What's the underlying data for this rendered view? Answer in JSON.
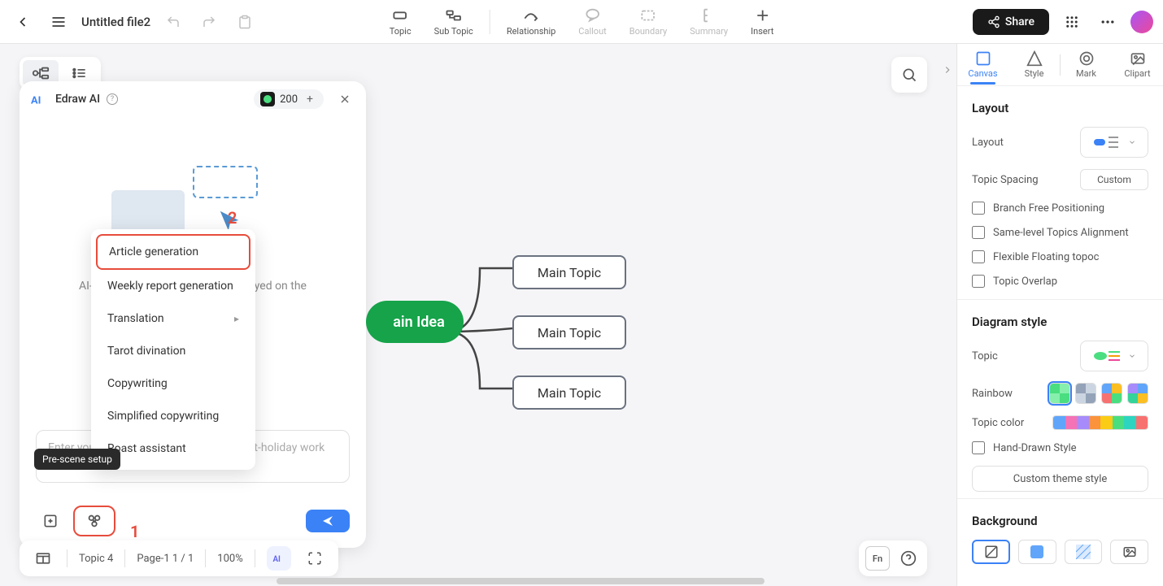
{
  "file": {
    "title": "Untitled file2"
  },
  "toolbar": {
    "topic": "Topic",
    "subtopic": "Sub Topic",
    "relationship": "Relationship",
    "callout": "Callout",
    "boundary": "Boundary",
    "summary": "Summary",
    "insert": "Insert"
  },
  "share": {
    "label": "Share"
  },
  "ai": {
    "title": "Edraw AI",
    "credits": "200",
    "hint": "AI-generated content can be displayed on the canvas~",
    "placeholder": "Enter your question, such as \"perfect post-holiday work resumption plan\"",
    "submenu": {
      "article": "Article generation",
      "weekly": "Weekly report generation",
      "translation": "Translation",
      "tarot": "Tarot divination",
      "copywriting": "Copywriting",
      "simplified": "Simplified copywriting",
      "roast": "Roast assistant"
    },
    "tooltip": "Pre-scene setup"
  },
  "annotations": {
    "one": "1",
    "two": "2"
  },
  "mindmap": {
    "root": "ain Idea",
    "child1": "Main Topic",
    "child2": "Main Topic",
    "child3": "Main Topic"
  },
  "rightPanel": {
    "tabs": {
      "canvas": "Canvas",
      "style": "Style",
      "mark": "Mark",
      "clipart": "Clipart"
    },
    "layout": {
      "title": "Layout",
      "layout_label": "Layout",
      "spacing_label": "Topic Spacing",
      "custom": "Custom",
      "branch_free": "Branch Free Positioning",
      "same_level": "Same-level Topics Alignment",
      "flexible": "Flexible Floating topoc",
      "overlap": "Topic Overlap"
    },
    "diagram": {
      "title": "Diagram style",
      "topic": "Topic",
      "rainbow": "Rainbow",
      "topic_color": "Topic color",
      "hand_drawn": "Hand-Drawn Style",
      "custom_theme": "Custom theme style"
    },
    "background": {
      "title": "Background"
    }
  },
  "bottomBar": {
    "topic_count": "Topic 4",
    "page": "Page-1  1 / 1",
    "zoom": "100%"
  },
  "colors": {
    "accent": "#3b82f6",
    "highlight": "#e74c3c",
    "root_node": "#16a34a"
  }
}
